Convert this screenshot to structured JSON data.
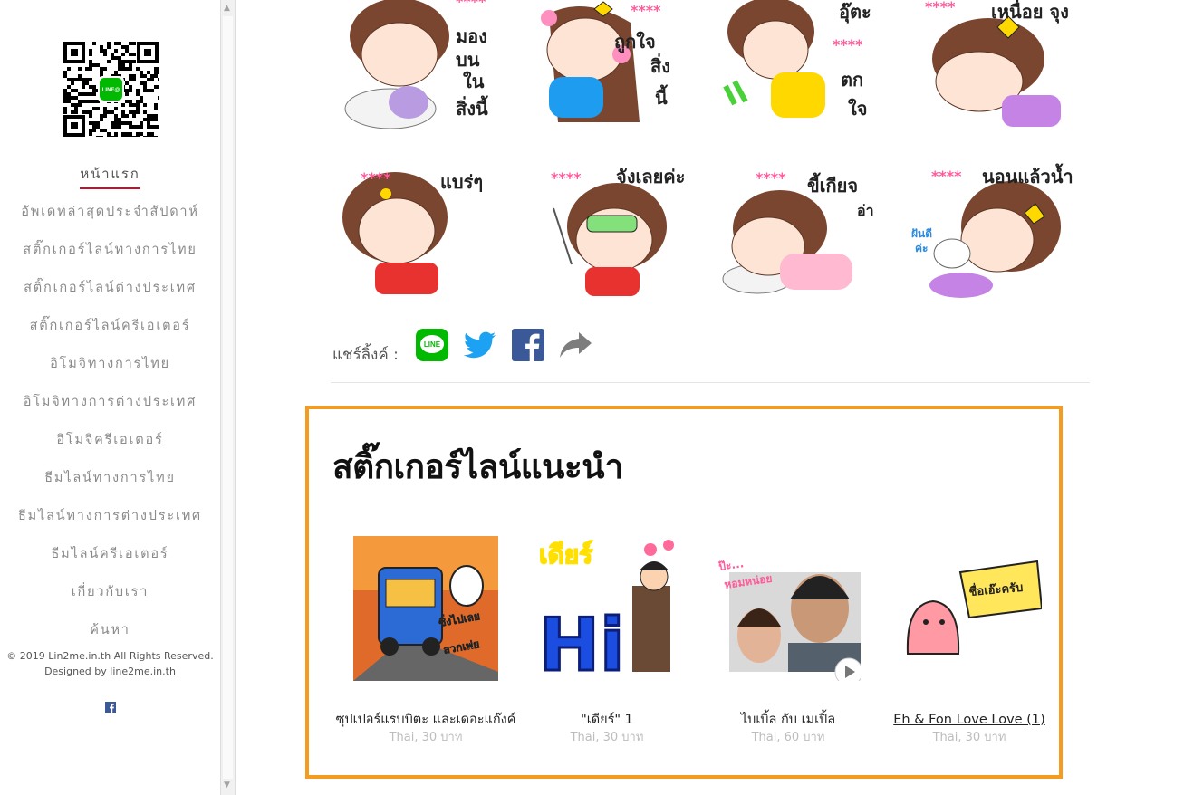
{
  "sidebar": {
    "home": "หน้าแรก",
    "items": [
      "อัพเดทล่าสุดประจำสัปดาห์",
      "สติ๊กเกอร์ไลน์ทางการไทย",
      "สติ๊กเกอร์ไลน์ต่างประเทศ",
      "สติ๊กเกอร์ไลน์ครีเอเตอร์",
      "อิโมจิทางการไทย",
      "อิโมจิทางการต่างประเทศ",
      "อิโมจิครีเอเตอร์",
      "ธีมไลน์ทางการไทย",
      "ธีมไลน์ทางการต่างประเทศ",
      "ธีมไลน์ครีเอเตอร์",
      "เกี่ยวกับเรา",
      "ค้นหา"
    ],
    "copyright": "© 2019 Lin2me.in.th All Rights Reserved.",
    "designed_by": "Designed by line2me.in.th",
    "qr_logo_text": "LINE@"
  },
  "stickers": [
    {
      "caption": "มอง บน ใน สิ่งนี้",
      "stars": "****"
    },
    {
      "caption": "ถูกใจ สิ่ง นี้",
      "stars": "****"
    },
    {
      "caption": "อุ๊ตะ ตก ใจ",
      "stars": "****"
    },
    {
      "caption": "เหนื่อย จุง",
      "stars": "****"
    },
    {
      "caption": "แบร่ๆ",
      "stars": "****"
    },
    {
      "caption": "จังเลยค่ะ",
      "stars": "****"
    },
    {
      "caption": "ขี้เกียจ อ่า",
      "stars": "****"
    },
    {
      "caption": "นอนแล้วน้ำ",
      "stars": "****",
      "extra": "ฝันดี ค่ะ"
    }
  ],
  "share": {
    "label": "แชร์ลิ้งค์ :",
    "line_icon_text": "LINE"
  },
  "recommended": {
    "heading": "สติ๊กเกอร์ไลน์แนะนำ",
    "items": [
      {
        "title": "ซุปเปอร์แรบบิตะ และเดอะแก๊งค์",
        "price": "Thai, 30 บาท",
        "art_text": [
          "ซิ่งไปเลย",
          "ลวกเพ่ย"
        ]
      },
      {
        "title": "\"เดียร์\" 1",
        "price": "Thai, 30 บาท",
        "art_text": [
          "เดียร์",
          "Hi"
        ]
      },
      {
        "title": "ไบเบิ้ล กับ เมเปิ้ล",
        "price": "Thai, 60 บาท",
        "art_text": [
          "ป๊ะ...",
          "หอมหน่อย"
        ]
      },
      {
        "title": "Eh & Fon Love Love (1)",
        "price": "Thai, 30 บาท",
        "art_text": [
          "ชื่อเอ๊ะครับ"
        ]
      }
    ]
  },
  "colors": {
    "accent_orange": "#f39c1f",
    "nav_underline": "#c8102e",
    "line_green": "#00b900",
    "twitter": "#1da1f2",
    "facebook": "#3b5998"
  }
}
